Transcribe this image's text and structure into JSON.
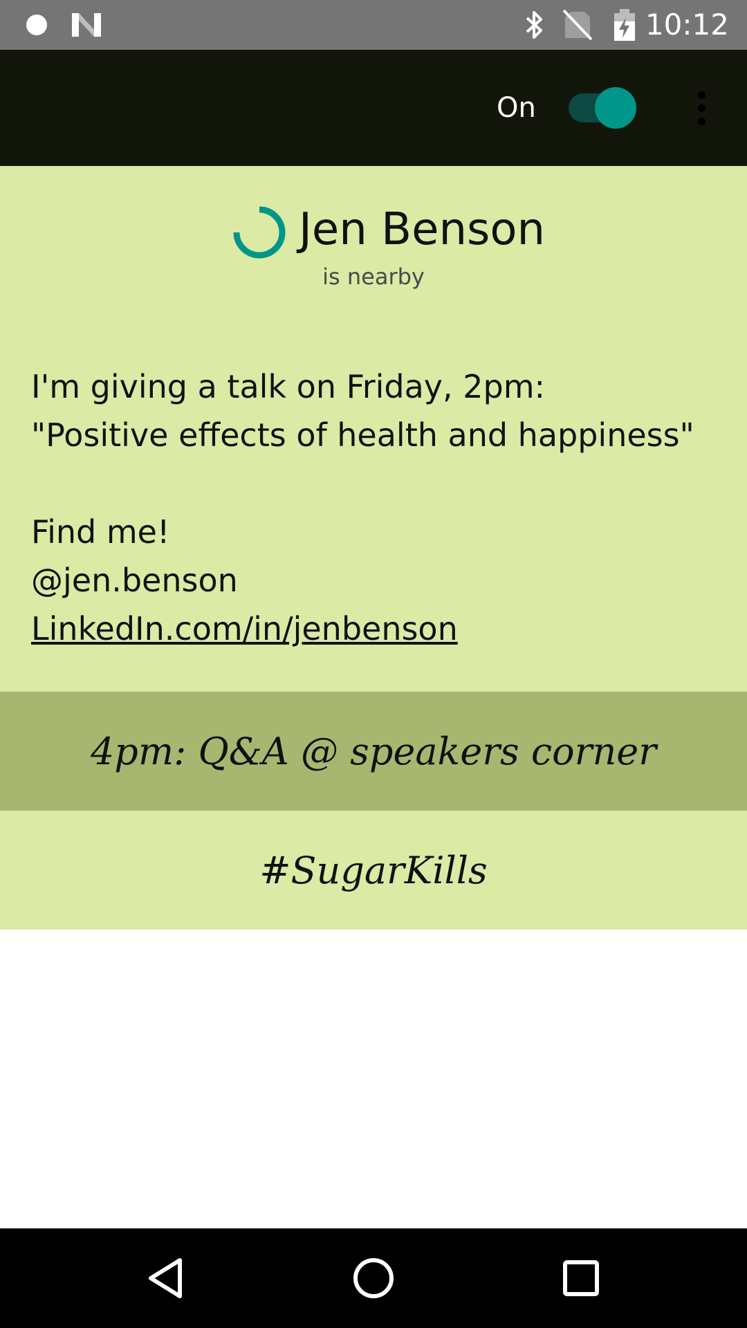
{
  "status_bar": {
    "time": "10:12",
    "icons": [
      "notification-dot-icon",
      "n-logo-icon",
      "bluetooth-icon",
      "no-sim-icon",
      "battery-charging-icon"
    ]
  },
  "app_bar": {
    "toggle_label": "On",
    "toggle_state": true,
    "menu_icon": "overflow-menu-icon"
  },
  "card": {
    "name": "Jen Benson",
    "subtitle": "is nearby",
    "message_lines": [
      "I'm giving a talk on Friday, 2pm:",
      "\"Positive effects of health and happiness\"",
      "",
      "Find me!",
      "@jen.benson"
    ],
    "link": "LinkedIn.com/in/jenbenson",
    "banner": "4pm: Q&A @ speakers corner",
    "hashtag": "#SugarKills"
  },
  "colors": {
    "status_bar": "#757575",
    "app_bar": "#12150a",
    "card_background": "#dbeaa5",
    "banner_background": "#a8b770",
    "accent": "#00968a"
  },
  "nav_bar": {
    "buttons": [
      "back-icon",
      "home-icon",
      "recents-icon"
    ]
  }
}
